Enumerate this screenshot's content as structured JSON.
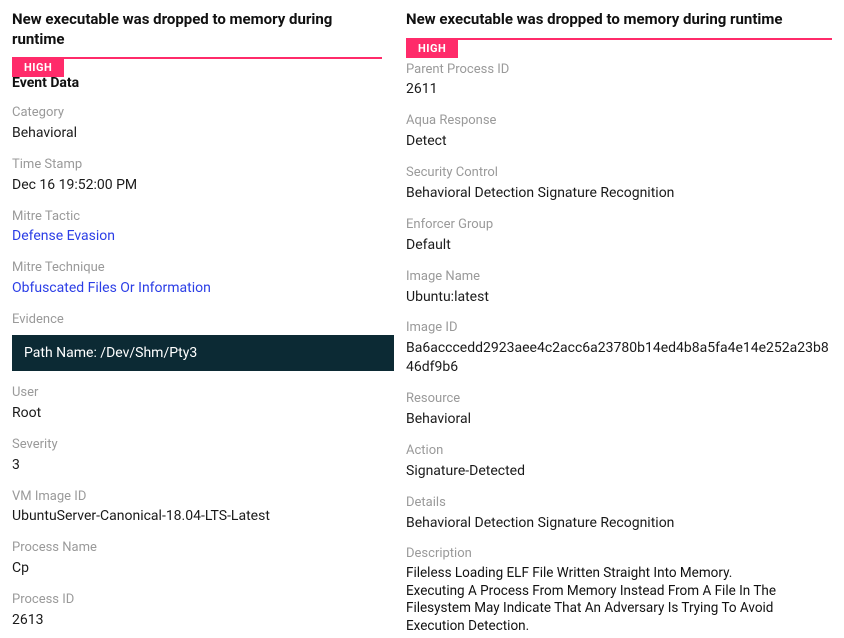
{
  "left": {
    "title": "New executable was dropped to memory during runtime",
    "badge": "HIGH",
    "section_header": "Event Data",
    "fields": {
      "category_label": "Category",
      "category_value": "Behavioral",
      "timestamp_label": "Time Stamp",
      "timestamp_value": "Dec 16 19:52:00 PM",
      "mitre_tactic_label": "Mitre Tactic",
      "mitre_tactic_value": "Defense Evasion",
      "mitre_technique_label": "Mitre Technique",
      "mitre_technique_value": "Obfuscated Files Or Information",
      "evidence_label": "Evidence",
      "evidence_value": "Path Name: /Dev/Shm/Pty3",
      "user_label": "User",
      "user_value": "Root",
      "severity_label": "Severity",
      "severity_value": "3",
      "vm_image_id_label": "VM Image ID",
      "vm_image_id_value": "UbuntuServer-Canonical-18.04-LTS-Latest",
      "process_name_label": "Process Name",
      "process_name_value": "Cp",
      "process_id_label": "Process ID",
      "process_id_value": "2613"
    }
  },
  "right": {
    "title": "New executable was dropped to memory during runtime",
    "badge": "HIGH",
    "fields": {
      "parent_pid_label": "Parent Process ID",
      "parent_pid_value": "2611",
      "aqua_response_label": "Aqua Response",
      "aqua_response_value": "Detect",
      "security_control_label": "Security Control",
      "security_control_value": "Behavioral Detection Signature Recognition",
      "enforcer_group_label": "Enforcer Group",
      "enforcer_group_value": "Default",
      "image_name_label": "Image Name",
      "image_name_value": "Ubuntu:latest",
      "image_id_label": "Image ID",
      "image_id_value": "Ba6acccedd2923aee4c2acc6a23780b14ed4b8a5fa4e14e252a23b846df9b6",
      "resource_label": "Resource",
      "resource_value": "Behavioral",
      "action_label": "Action",
      "action_value": "Signature-Detected",
      "details_label": "Details",
      "details_value": "Behavioral Detection Signature Recognition",
      "description_label": "Description",
      "description_value": "Fileless Loading ELF File Written Straight Into Memory. Executing A Process From Memory Instead From A File In The Filesystem May Indicate That An Adversary Is Trying To Avoid Execution Detection."
    }
  }
}
